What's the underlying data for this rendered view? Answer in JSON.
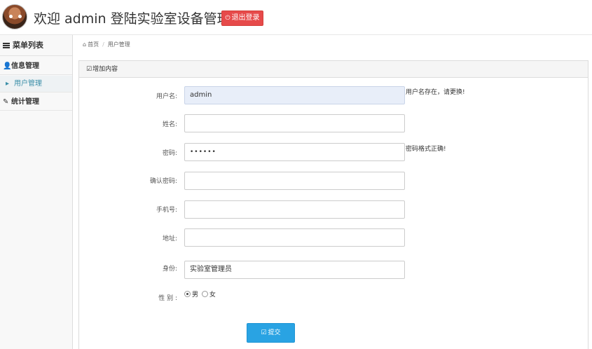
{
  "header": {
    "title": "欢迎 admin 登陆实验室设备管理系统",
    "logout_label": "退出登录"
  },
  "sidebar": {
    "menu_title": "菜单列表",
    "items": [
      {
        "label": "信息管理",
        "icon": "user-icon",
        "level": "group"
      },
      {
        "label": "用户管理",
        "icon": "caret-right-icon",
        "level": "sub",
        "active": true
      },
      {
        "label": "统计管理",
        "icon": "edit-icon",
        "level": "group"
      }
    ]
  },
  "breadcrumb": {
    "home": "首页",
    "current": "用户管理"
  },
  "panel": {
    "title": "增加内容"
  },
  "form": {
    "username": {
      "label": "用户名:",
      "value": "admin",
      "hint": "用户名存在，请更换!"
    },
    "name": {
      "label": "姓名:",
      "value": ""
    },
    "password": {
      "label": "密码:",
      "value": "••••••",
      "hint": "密码格式正确!"
    },
    "confirm_password": {
      "label": "确认密码:",
      "value": ""
    },
    "phone": {
      "label": "手机号:",
      "value": ""
    },
    "address": {
      "label": "地址:",
      "value": ""
    },
    "role": {
      "label": "身份:",
      "value": "实验室管理员"
    },
    "gender": {
      "label": "性 别 :",
      "options": [
        "男",
        "女"
      ],
      "selected": "男"
    },
    "submit_label": "提交"
  },
  "colors": {
    "logout": "#e64a4a",
    "submit": "#29a3e3",
    "active_link": "#3a8ea8"
  }
}
